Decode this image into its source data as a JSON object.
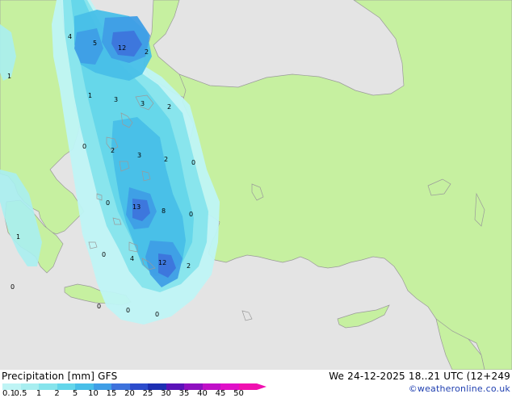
{
  "header": {
    "title": "Precipitation [mm]  GFS",
    "valid_time": "We 24-12-2025 18..21 UTC (12+249",
    "credit": "©weatheronline.co.uk"
  },
  "legend": {
    "levels": [
      {
        "label": "0.1",
        "color": "#bff4f5"
      },
      {
        "label": "0.5",
        "color": "#a8eef0"
      },
      {
        "label": "1",
        "color": "#86e4ec"
      },
      {
        "label": "2",
        "color": "#64d6ea"
      },
      {
        "label": "5",
        "color": "#48bfe8"
      },
      {
        "label": "10",
        "color": "#3f9ee6"
      },
      {
        "label": "15",
        "color": "#3d72dc"
      },
      {
        "label": "20",
        "color": "#2c4ccc"
      },
      {
        "label": "25",
        "color": "#1d2fb2"
      },
      {
        "label": "30",
        "color": "#5a12b8"
      },
      {
        "label": "35",
        "color": "#8e10c0"
      },
      {
        "label": "40",
        "color": "#c010c8"
      },
      {
        "label": "45",
        "color": "#e010c8"
      },
      {
        "label": "50",
        "color": "#f010b0"
      }
    ]
  },
  "map": {
    "land_color": "#c6f0a0",
    "sea_color": "#e4e4e4",
    "border_color": "#a0a0a0",
    "values": [
      {
        "text": "4"
      },
      {
        "text": "5"
      },
      {
        "text": "12"
      },
      {
        "text": "2"
      },
      {
        "text": "1"
      },
      {
        "text": "1"
      },
      {
        "text": "3"
      },
      {
        "text": "3"
      },
      {
        "text": "2"
      },
      {
        "text": "0"
      },
      {
        "text": "2"
      },
      {
        "text": "3"
      },
      {
        "text": "2"
      },
      {
        "text": "0"
      },
      {
        "text": "0"
      },
      {
        "text": "13"
      },
      {
        "text": "8"
      },
      {
        "text": "0"
      },
      {
        "text": "1"
      },
      {
        "text": "0"
      },
      {
        "text": "4"
      },
      {
        "text": "12"
      },
      {
        "text": "2"
      },
      {
        "text": "0"
      },
      {
        "text": "0"
      },
      {
        "text": "0"
      },
      {
        "text": "0"
      }
    ]
  }
}
